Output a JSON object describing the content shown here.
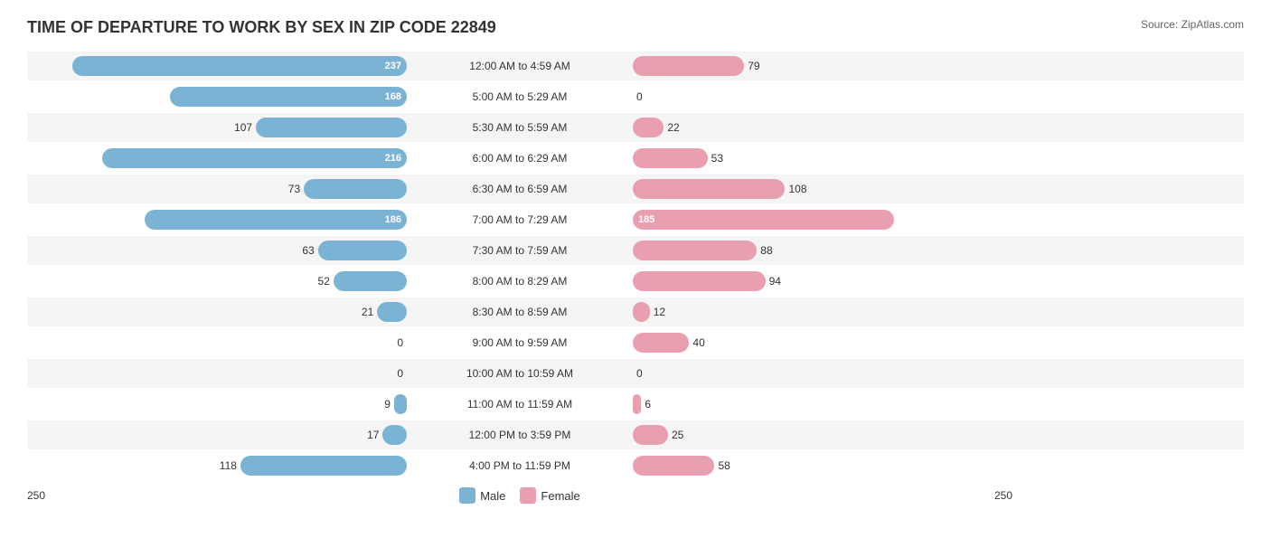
{
  "title": "TIME OF DEPARTURE TO WORK BY SEX IN ZIP CODE 22849",
  "source": "Source: ZipAtlas.com",
  "colors": {
    "male": "#7ab3d4",
    "female": "#e8a0b0"
  },
  "axis_min": "250",
  "axis_max": "250",
  "legend": {
    "male_label": "Male",
    "female_label": "Female"
  },
  "rows": [
    {
      "label": "12:00 AM to 4:59 AM",
      "male": 237,
      "female": 79,
      "male_show_inside": true,
      "female_show_inside": false
    },
    {
      "label": "5:00 AM to 5:29 AM",
      "male": 168,
      "female": 0,
      "male_show_inside": true,
      "female_show_inside": false
    },
    {
      "label": "5:30 AM to 5:59 AM",
      "male": 107,
      "female": 22,
      "male_show_inside": false,
      "female_show_inside": false
    },
    {
      "label": "6:00 AM to 6:29 AM",
      "male": 216,
      "female": 53,
      "male_show_inside": true,
      "female_show_inside": false
    },
    {
      "label": "6:30 AM to 6:59 AM",
      "male": 73,
      "female": 108,
      "male_show_inside": false,
      "female_show_inside": false
    },
    {
      "label": "7:00 AM to 7:29 AM",
      "male": 186,
      "female": 185,
      "male_show_inside": true,
      "female_show_inside": true
    },
    {
      "label": "7:30 AM to 7:59 AM",
      "male": 63,
      "female": 88,
      "male_show_inside": false,
      "female_show_inside": false
    },
    {
      "label": "8:00 AM to 8:29 AM",
      "male": 52,
      "female": 94,
      "male_show_inside": false,
      "female_show_inside": false
    },
    {
      "label": "8:30 AM to 8:59 AM",
      "male": 21,
      "female": 12,
      "male_show_inside": false,
      "female_show_inside": false
    },
    {
      "label": "9:00 AM to 9:59 AM",
      "male": 0,
      "female": 40,
      "male_show_inside": false,
      "female_show_inside": false
    },
    {
      "label": "10:00 AM to 10:59 AM",
      "male": 0,
      "female": 0,
      "male_show_inside": false,
      "female_show_inside": false
    },
    {
      "label": "11:00 AM to 11:59 AM",
      "male": 9,
      "female": 6,
      "male_show_inside": false,
      "female_show_inside": false
    },
    {
      "label": "12:00 PM to 3:59 PM",
      "male": 17,
      "female": 25,
      "male_show_inside": false,
      "female_show_inside": false
    },
    {
      "label": "4:00 PM to 11:59 PM",
      "male": 118,
      "female": 58,
      "male_show_inside": false,
      "female_show_inside": false
    }
  ],
  "max_value": 250
}
